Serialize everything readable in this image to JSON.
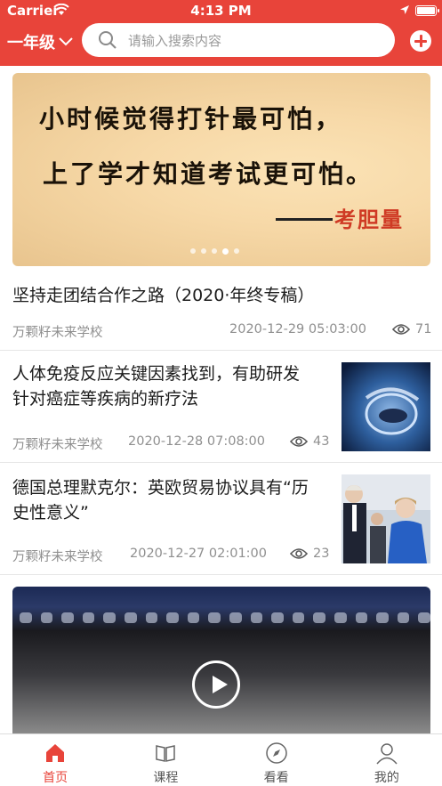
{
  "status_bar": {
    "carrier": "Carrier",
    "time": "4:13 PM"
  },
  "header": {
    "grade": "一年级",
    "search_placeholder": "请输入搜索内容"
  },
  "banner": {
    "line1": "小时候觉得打针最可怕，",
    "line2": "上了学才知道考试更可怕。",
    "signature": "考胆量",
    "page_count": 5,
    "active_page": 4
  },
  "articles": [
    {
      "title": "坚持走团结合作之路（2020·年终专稿）",
      "source": "万颗籽未来学校",
      "date": "2020-12-29 05:03:00",
      "views": "71"
    },
    {
      "title_line1": "人体免疫反应关键因素找到，有助研发",
      "title_line2": "针对癌症等疾病的新疗法",
      "source": "万颗籽未来学校",
      "date": "2020-12-28 07:08:00",
      "views": "43",
      "thumb": "blue-vial-image"
    },
    {
      "title_line1": "德国总理默克尔：英欧贸易协议具有“历",
      "title_line2": "史性意义”",
      "source": "万颗籽未来学校",
      "date": "2020-12-27 02:01:00",
      "views": "23",
      "thumb": "politicians-photo"
    }
  ],
  "tabs": [
    {
      "label": "首页",
      "icon": "home-icon",
      "active": true
    },
    {
      "label": "课程",
      "icon": "book-icon",
      "active": false
    },
    {
      "label": "看看",
      "icon": "compass-icon",
      "active": false
    },
    {
      "label": "我的",
      "icon": "user-icon",
      "active": false
    }
  ],
  "colors": {
    "brand": "#e8443a",
    "text": "#1c1c1c",
    "meta": "#8f8f8f"
  }
}
